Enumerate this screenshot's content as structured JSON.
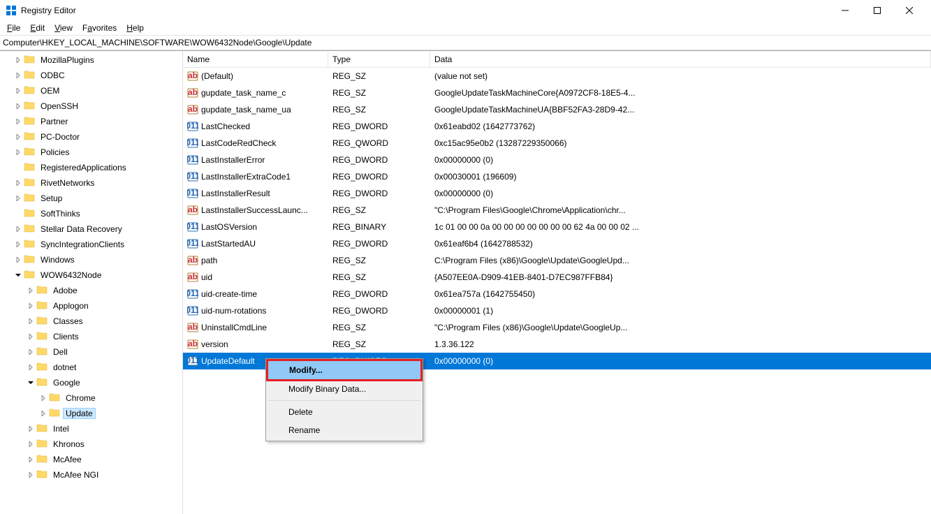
{
  "window": {
    "title": "Registry Editor"
  },
  "menubar": {
    "file": "File",
    "edit": "Edit",
    "view": "View",
    "favorites": "Favorites",
    "help": "Help"
  },
  "address": "Computer\\HKEY_LOCAL_MACHINE\\SOFTWARE\\WOW6432Node\\Google\\Update",
  "columns": {
    "name": "Name",
    "type": "Type",
    "data": "Data"
  },
  "tree": [
    {
      "label": "MozillaPlugins",
      "depth": 1,
      "exp": ">"
    },
    {
      "label": "ODBC",
      "depth": 1,
      "exp": ">"
    },
    {
      "label": "OEM",
      "depth": 1,
      "exp": ">"
    },
    {
      "label": "OpenSSH",
      "depth": 1,
      "exp": ">"
    },
    {
      "label": "Partner",
      "depth": 1,
      "exp": ">"
    },
    {
      "label": "PC-Doctor",
      "depth": 1,
      "exp": ">"
    },
    {
      "label": "Policies",
      "depth": 1,
      "exp": ">"
    },
    {
      "label": "RegisteredApplications",
      "depth": 1,
      "exp": ""
    },
    {
      "label": "RivetNetworks",
      "depth": 1,
      "exp": ">"
    },
    {
      "label": "Setup",
      "depth": 1,
      "exp": ">"
    },
    {
      "label": "SoftThinks",
      "depth": 1,
      "exp": ""
    },
    {
      "label": "Stellar Data Recovery",
      "depth": 1,
      "exp": ">"
    },
    {
      "label": "SyncIntegrationClients",
      "depth": 1,
      "exp": ">"
    },
    {
      "label": "Windows",
      "depth": 1,
      "exp": ">"
    },
    {
      "label": "WOW6432Node",
      "depth": 1,
      "exp": "v"
    },
    {
      "label": "Adobe",
      "depth": 2,
      "exp": ">"
    },
    {
      "label": "Applogon",
      "depth": 2,
      "exp": ">"
    },
    {
      "label": "Classes",
      "depth": 2,
      "exp": ">"
    },
    {
      "label": "Clients",
      "depth": 2,
      "exp": ">"
    },
    {
      "label": "Dell",
      "depth": 2,
      "exp": ">"
    },
    {
      "label": "dotnet",
      "depth": 2,
      "exp": ">"
    },
    {
      "label": "Google",
      "depth": 2,
      "exp": "v"
    },
    {
      "label": "Chrome",
      "depth": 3,
      "exp": ">"
    },
    {
      "label": "Update",
      "depth": 3,
      "exp": ">",
      "selected": true
    },
    {
      "label": "Intel",
      "depth": 2,
      "exp": ">"
    },
    {
      "label": "Khronos",
      "depth": 2,
      "exp": ">"
    },
    {
      "label": "McAfee",
      "depth": 2,
      "exp": ">"
    },
    {
      "label": "McAfee NGI",
      "depth": 2,
      "exp": ">"
    }
  ],
  "values": [
    {
      "name": "(Default)",
      "type": "REG_SZ",
      "data": "(value not set)",
      "icon": "sz"
    },
    {
      "name": "gupdate_task_name_c",
      "type": "REG_SZ",
      "data": "GoogleUpdateTaskMachineCore{A0972CF8-18E5-4...",
      "icon": "sz"
    },
    {
      "name": "gupdate_task_name_ua",
      "type": "REG_SZ",
      "data": "GoogleUpdateTaskMachineUA{BBF52FA3-28D9-42...",
      "icon": "sz"
    },
    {
      "name": "LastChecked",
      "type": "REG_DWORD",
      "data": "0x61eabd02 (1642773762)",
      "icon": "bin"
    },
    {
      "name": "LastCodeRedCheck",
      "type": "REG_QWORD",
      "data": "0xc15ac95e0b2 (13287229350066)",
      "icon": "bin"
    },
    {
      "name": "LastInstallerError",
      "type": "REG_DWORD",
      "data": "0x00000000 (0)",
      "icon": "bin"
    },
    {
      "name": "LastInstallerExtraCode1",
      "type": "REG_DWORD",
      "data": "0x00030001 (196609)",
      "icon": "bin"
    },
    {
      "name": "LastInstallerResult",
      "type": "REG_DWORD",
      "data": "0x00000000 (0)",
      "icon": "bin"
    },
    {
      "name": "LastInstallerSuccessLaunc...",
      "type": "REG_SZ",
      "data": "\"C:\\Program Files\\Google\\Chrome\\Application\\chr...",
      "icon": "sz"
    },
    {
      "name": "LastOSVersion",
      "type": "REG_BINARY",
      "data": "1c 01 00 00 0a 00 00 00 00 00 00 00 62 4a 00 00 02 ...",
      "icon": "bin"
    },
    {
      "name": "LastStartedAU",
      "type": "REG_DWORD",
      "data": "0x61eaf6b4 (1642788532)",
      "icon": "bin"
    },
    {
      "name": "path",
      "type": "REG_SZ",
      "data": "C:\\Program Files (x86)\\Google\\Update\\GoogleUpd...",
      "icon": "sz"
    },
    {
      "name": "uid",
      "type": "REG_SZ",
      "data": "{A507EE0A-D909-41EB-8401-D7EC987FFB84}",
      "icon": "sz"
    },
    {
      "name": "uid-create-time",
      "type": "REG_DWORD",
      "data": "0x61ea757a (1642755450)",
      "icon": "bin"
    },
    {
      "name": "uid-num-rotations",
      "type": "REG_DWORD",
      "data": "0x00000001 (1)",
      "icon": "bin"
    },
    {
      "name": "UninstallCmdLine",
      "type": "REG_SZ",
      "data": "\"C:\\Program Files (x86)\\Google\\Update\\GoogleUp...",
      "icon": "sz"
    },
    {
      "name": "version",
      "type": "REG_SZ",
      "data": "1.3.36.122",
      "icon": "sz"
    },
    {
      "name": "UpdateDefault",
      "type": "REG_DWORD",
      "data": "0x00000000 (0)",
      "icon": "bin",
      "selected": true
    }
  ],
  "context_menu": {
    "modify": "Modify...",
    "modify_binary": "Modify Binary Data...",
    "delete": "Delete",
    "rename": "Rename"
  }
}
